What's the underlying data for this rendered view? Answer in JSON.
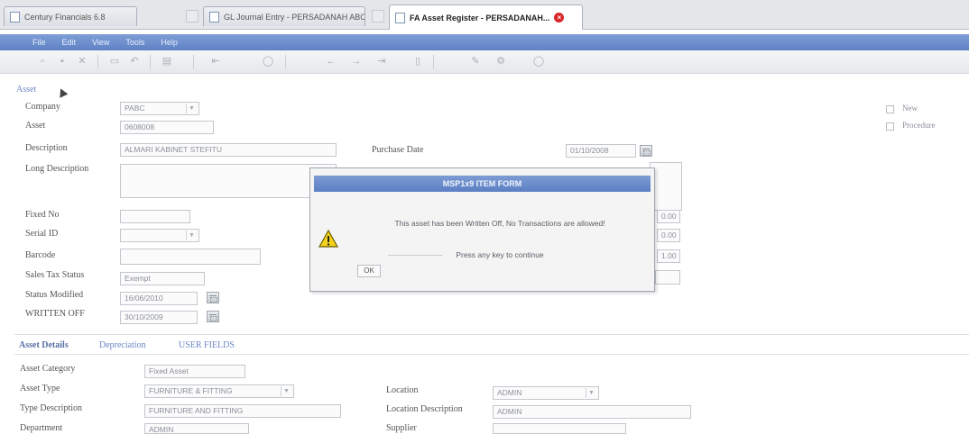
{
  "browser": {
    "tabs": [
      {
        "label": "Century Financials 6.8"
      },
      {
        "label": "GL Journal Entry - PERSADANAH ABC"
      },
      {
        "label": "FA Asset Register - PERSADANAH...",
        "active": true
      }
    ]
  },
  "menu": [
    "File",
    "Edit",
    "View",
    "Tools",
    "Help"
  ],
  "toolbar": {
    "icons": [
      "new-icon",
      "save-icon",
      "delete-icon",
      "print-icon",
      "undo-icon",
      "refresh-icon",
      "first-icon",
      "prev-icon",
      "next-icon",
      "last-icon",
      "find-icon",
      "attach-icon",
      "help-icon"
    ]
  },
  "form": {
    "section_title": "Asset",
    "company": {
      "label": "Company",
      "value": "PABC"
    },
    "asset": {
      "label": "Asset",
      "value": "0608008"
    },
    "description": {
      "label": "Description",
      "value": "ALMARI KABINET STEFITU"
    },
    "long_description": {
      "label": "Long Description",
      "value": ""
    },
    "fixed_no": {
      "label": "Fixed No",
      "value": ""
    },
    "serial_id": {
      "label": "Serial ID",
      "value": ""
    },
    "barcode": {
      "label": "Barcode",
      "value": ""
    },
    "sales_tax_status": {
      "label": "Sales Tax Status",
      "value": "Exempt"
    },
    "status_modified": {
      "label": "Status Modified",
      "value": "16/06/2010"
    },
    "written_off": {
      "label": "WRITTEN OFF",
      "value": "30/10/2009"
    },
    "purchase_date": {
      "label": "Purchase Date",
      "value": "01/10/2008"
    },
    "right_values": [
      "0.00",
      "0.00",
      "1.00"
    ],
    "checkboxes": [
      {
        "label": "New"
      },
      {
        "label": "Procedure"
      }
    ]
  },
  "dialog": {
    "title": "MSP1x9 ITEM FORM",
    "message": "This asset has been Written Off, No Transactions are allowed!",
    "press": "Press any key to continue",
    "ok_label": "OK"
  },
  "detail_tabs": [
    "Asset Details",
    "Depreciation",
    "USER FIELDS"
  ],
  "details": {
    "asset_category": {
      "label": "Asset Category",
      "value": "Fixed Asset"
    },
    "asset_type": {
      "label": "Asset Type",
      "value": "FURNITURE & FITTING"
    },
    "type_description": {
      "label": "Type Description",
      "value": "FURNITURE AND FITTING"
    },
    "department": {
      "label": "Department",
      "value": "ADMIN"
    },
    "location": {
      "label": "Location",
      "value": "ADMIN"
    },
    "location_description": {
      "label": "Location Description",
      "value": "ADMIN"
    },
    "supplier": {
      "label": "Supplier",
      "value": ""
    }
  },
  "colors": {
    "menubar": "#6b8bcc",
    "dialog_title": "#6a8dcb",
    "link": "#6d86c6",
    "warning": "#f2d21a"
  }
}
